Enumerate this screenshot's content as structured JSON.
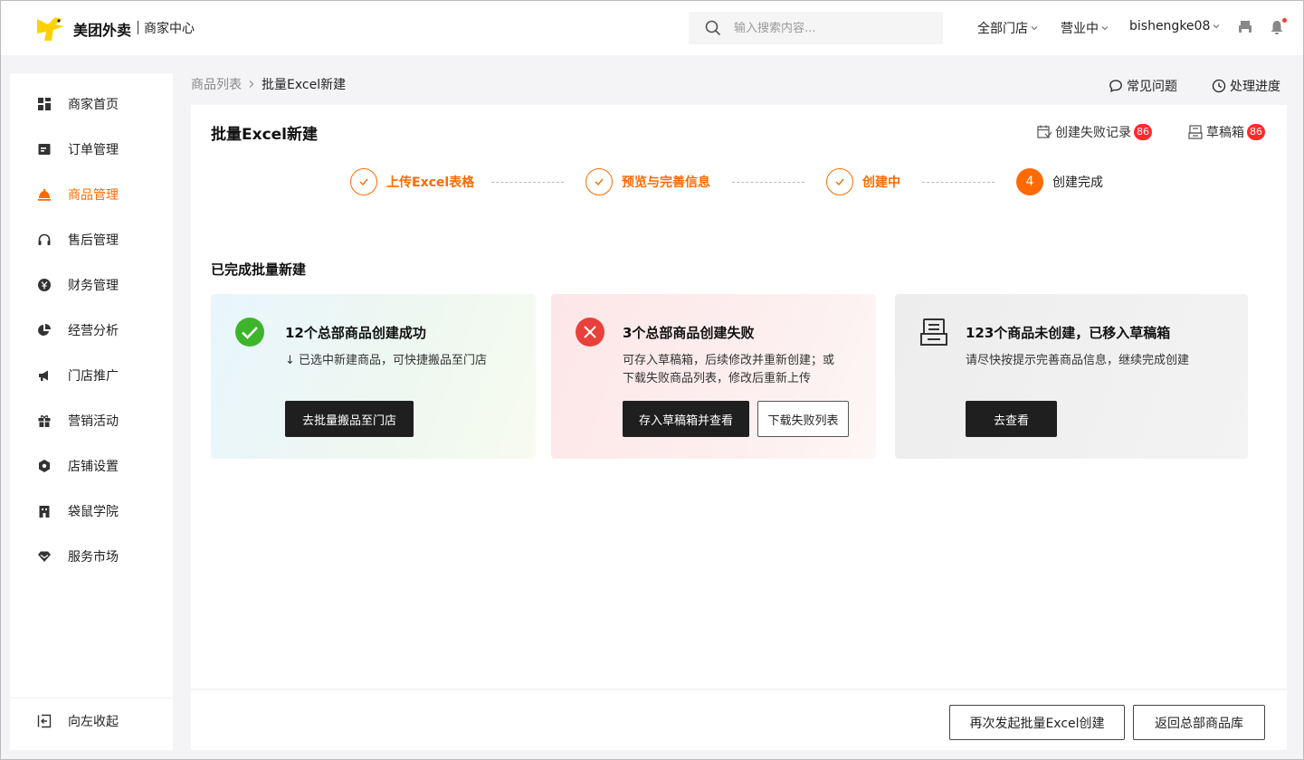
{
  "header": {
    "brand": "美团外卖",
    "sub_brand": "商家中心",
    "search_placeholder": "输入搜索内容...",
    "store_select": "全部门店",
    "status_select": "营业中",
    "username": "bishengke08"
  },
  "sidebar": {
    "items": [
      {
        "label": "商家首页",
        "icon": "dashboard-icon"
      },
      {
        "label": "订单管理",
        "icon": "order-icon"
      },
      {
        "label": "商品管理",
        "icon": "dish-cover-icon"
      },
      {
        "label": "售后管理",
        "icon": "headset-icon"
      },
      {
        "label": "财务管理",
        "icon": "yuan-icon"
      },
      {
        "label": "经营分析",
        "icon": "pie-chart-icon"
      },
      {
        "label": "门店推广",
        "icon": "megaphone-icon"
      },
      {
        "label": "营销活动",
        "icon": "gift-icon"
      },
      {
        "label": "店铺设置",
        "icon": "hexagon-gear-icon"
      },
      {
        "label": "袋鼠学院",
        "icon": "school-icon"
      },
      {
        "label": "服务市场",
        "icon": "diamond-icon"
      }
    ],
    "collapse_label": "向左收起"
  },
  "breadcrumb": {
    "parent": "商品列表",
    "current": "批量Excel新建"
  },
  "top_links": {
    "faq": "常见问题",
    "progress": "处理进度"
  },
  "panel": {
    "title": "批量Excel新建",
    "fail_records_label": "创建失败记录",
    "fail_records_count": "86",
    "drafts_label": "草稿箱",
    "drafts_count": "86",
    "steps": [
      {
        "label": "上传Excel表格"
      },
      {
        "label": "预览与完善信息"
      },
      {
        "label": "创建中"
      },
      {
        "label": "创建完成",
        "number": "4"
      }
    ],
    "section_title": "已完成批量新建",
    "cards": {
      "success": {
        "title": "12个总部商品创建成功",
        "desc": "↓ 已选中新建商品，可快捷搬品至门店",
        "button": "去批量搬品至门店"
      },
      "failed": {
        "title": "3个总部商品创建失败",
        "desc_line1": "可存入草稿箱，后续修改并重新创建；或",
        "desc_line2": "下载失败商品列表，修改后重新上传",
        "button_primary": "存入草稿箱并查看",
        "button_secondary": "下载失败列表"
      },
      "draft": {
        "title": "123个商品未创建，已移入草稿箱",
        "desc": "请尽快按提示完善商品信息，继续完成创建",
        "button": "去查看"
      }
    }
  },
  "footer": {
    "restart_button": "再次发起批量Excel创建",
    "back_button": "返回总部商品库"
  },
  "colors": {
    "accent": "#ff6a00",
    "success": "#3cb52a",
    "error": "#e8403a",
    "badge": "#ff2b2b",
    "dark_button": "#1f1f1f"
  }
}
